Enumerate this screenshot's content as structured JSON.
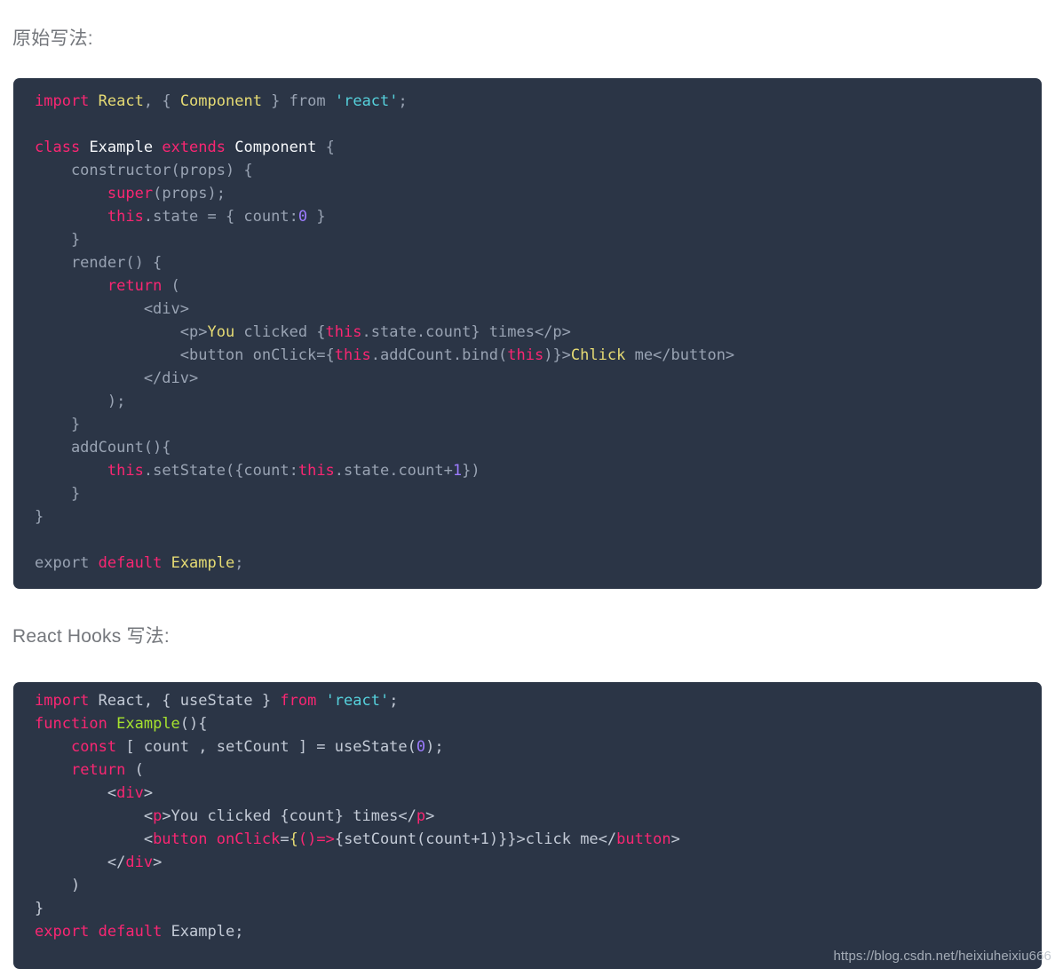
{
  "page": {
    "background": "#ffffff",
    "code_background": "#2b3546",
    "heading_color": "#74777c"
  },
  "headings": {
    "first": "原始写法:",
    "second": "React Hooks 写法:"
  },
  "watermark": "https://blog.csdn.net/heixiuheixiu666",
  "palette": {
    "keyword_pink": "#f92672",
    "yellow": "#e6db74",
    "cyan": "#56d1dc",
    "green": "#a6e22e",
    "purple": "#9d7cff",
    "grey": "#c3cad6",
    "white": "#f5f7fa"
  },
  "code_block_1": {
    "language": "jsx",
    "lines": [
      [
        {
          "t": "import",
          "c": "t-kw"
        },
        {
          "t": " ",
          "c": "t-plain"
        },
        {
          "t": "React",
          "c": "t-yellow"
        },
        {
          "t": ", { ",
          "c": "t-grey"
        },
        {
          "t": "Component",
          "c": "t-yellow"
        },
        {
          "t": " } ",
          "c": "t-grey"
        },
        {
          "t": "from",
          "c": "t-grey"
        },
        {
          "t": " ",
          "c": "t-plain"
        },
        {
          "t": "'react'",
          "c": "t-cyan"
        },
        {
          "t": ";",
          "c": "t-grey"
        }
      ],
      [
        {
          "t": "",
          "c": "t-plain"
        }
      ],
      [
        {
          "t": "class",
          "c": "t-kw"
        },
        {
          "t": " ",
          "c": "t-plain"
        },
        {
          "t": "Example",
          "c": "t-white"
        },
        {
          "t": " ",
          "c": "t-plain"
        },
        {
          "t": "extends",
          "c": "t-kw"
        },
        {
          "t": " ",
          "c": "t-plain"
        },
        {
          "t": "Component",
          "c": "t-white"
        },
        {
          "t": " {",
          "c": "t-grey"
        }
      ],
      [
        {
          "t": "    constructor(props) {",
          "c": "t-grey"
        }
      ],
      [
        {
          "t": "        ",
          "c": "t-plain"
        },
        {
          "t": "super",
          "c": "t-kw2"
        },
        {
          "t": "(props);",
          "c": "t-grey"
        }
      ],
      [
        {
          "t": "        ",
          "c": "t-plain"
        },
        {
          "t": "this",
          "c": "t-kw2"
        },
        {
          "t": ".state = { count:",
          "c": "t-grey"
        },
        {
          "t": "0",
          "c": "t-purple"
        },
        {
          "t": " }",
          "c": "t-grey"
        }
      ],
      [
        {
          "t": "    }",
          "c": "t-grey"
        }
      ],
      [
        {
          "t": "    render() {",
          "c": "t-grey"
        }
      ],
      [
        {
          "t": "        ",
          "c": "t-plain"
        },
        {
          "t": "return",
          "c": "t-kw"
        },
        {
          "t": " (",
          "c": "t-grey"
        }
      ],
      [
        {
          "t": "            <div>",
          "c": "t-grey"
        }
      ],
      [
        {
          "t": "                <p>",
          "c": "t-grey"
        },
        {
          "t": "You",
          "c": "t-yellow"
        },
        {
          "t": " clicked {",
          "c": "t-grey"
        },
        {
          "t": "this",
          "c": "t-kw2"
        },
        {
          "t": ".state.count} times</p>",
          "c": "t-grey"
        }
      ],
      [
        {
          "t": "                <button onClick={",
          "c": "t-grey"
        },
        {
          "t": "this",
          "c": "t-kw2"
        },
        {
          "t": ".addCount.bind(",
          "c": "t-grey"
        },
        {
          "t": "this",
          "c": "t-kw2"
        },
        {
          "t": ")}>",
          "c": "t-grey"
        },
        {
          "t": "Chlick",
          "c": "t-yellow"
        },
        {
          "t": " me</button>",
          "c": "t-grey"
        }
      ],
      [
        {
          "t": "            </div>",
          "c": "t-grey"
        }
      ],
      [
        {
          "t": "        );",
          "c": "t-grey"
        }
      ],
      [
        {
          "t": "    }",
          "c": "t-grey"
        }
      ],
      [
        {
          "t": "    addCount(){",
          "c": "t-grey"
        }
      ],
      [
        {
          "t": "        ",
          "c": "t-plain"
        },
        {
          "t": "this",
          "c": "t-kw2"
        },
        {
          "t": ".setState({count:",
          "c": "t-grey"
        },
        {
          "t": "this",
          "c": "t-kw2"
        },
        {
          "t": ".state.count+",
          "c": "t-grey"
        },
        {
          "t": "1",
          "c": "t-purple"
        },
        {
          "t": "})",
          "c": "t-grey"
        }
      ],
      [
        {
          "t": "    }",
          "c": "t-grey"
        }
      ],
      [
        {
          "t": "}",
          "c": "t-grey"
        }
      ],
      [
        {
          "t": "",
          "c": "t-plain"
        }
      ],
      [
        {
          "t": "export",
          "c": "t-grey"
        },
        {
          "t": " ",
          "c": "t-plain"
        },
        {
          "t": "default",
          "c": "t-kw"
        },
        {
          "t": " ",
          "c": "t-plain"
        },
        {
          "t": "Example",
          "c": "t-yellow"
        },
        {
          "t": ";",
          "c": "t-grey"
        }
      ]
    ]
  },
  "code_block_2": {
    "language": "jsx",
    "lines": [
      [
        {
          "t": "import",
          "c": "h-pink"
        },
        {
          "t": " React, { useState } ",
          "c": "h-grey"
        },
        {
          "t": "from",
          "c": "h-pink"
        },
        {
          "t": " ",
          "c": "h-grey"
        },
        {
          "t": "'react'",
          "c": "h-cyan"
        },
        {
          "t": ";",
          "c": "h-grey"
        }
      ],
      [
        {
          "t": "function",
          "c": "h-pink"
        },
        {
          "t": " ",
          "c": "h-grey"
        },
        {
          "t": "Example",
          "c": "h-green"
        },
        {
          "t": "(){",
          "c": "h-grey"
        }
      ],
      [
        {
          "t": "    ",
          "c": "h-grey"
        },
        {
          "t": "const",
          "c": "h-pink"
        },
        {
          "t": " [ count , setCount ] = useState(",
          "c": "h-grey"
        },
        {
          "t": "0",
          "c": "h-purple"
        },
        {
          "t": ");",
          "c": "h-grey"
        }
      ],
      [
        {
          "t": "    ",
          "c": "h-grey"
        },
        {
          "t": "return",
          "c": "h-pink"
        },
        {
          "t": " (",
          "c": "h-grey"
        }
      ],
      [
        {
          "t": "        <",
          "c": "h-grey"
        },
        {
          "t": "div",
          "c": "h-pink"
        },
        {
          "t": ">",
          "c": "h-grey"
        }
      ],
      [
        {
          "t": "            <",
          "c": "h-grey"
        },
        {
          "t": "p",
          "c": "h-pink"
        },
        {
          "t": ">You clicked {count} times</",
          "c": "h-grey"
        },
        {
          "t": "p",
          "c": "h-pink"
        },
        {
          "t": ">",
          "c": "h-grey"
        }
      ],
      [
        {
          "t": "            <",
          "c": "h-grey"
        },
        {
          "t": "button",
          "c": "h-pink"
        },
        {
          "t": " ",
          "c": "h-grey"
        },
        {
          "t": "onClick",
          "c": "h-pink"
        },
        {
          "t": "=",
          "c": "h-grey"
        },
        {
          "t": "{",
          "c": "h-yellow"
        },
        {
          "t": "()",
          "c": "h-pink"
        },
        {
          "t": "=>",
          "c": "h-pink"
        },
        {
          "t": "{setCount(count+1)}}>click me</",
          "c": "h-grey"
        },
        {
          "t": "button",
          "c": "h-pink"
        },
        {
          "t": ">",
          "c": "h-grey"
        }
      ],
      [
        {
          "t": "        </",
          "c": "h-grey"
        },
        {
          "t": "div",
          "c": "h-pink"
        },
        {
          "t": ">",
          "c": "h-grey"
        }
      ],
      [
        {
          "t": "    )",
          "c": "h-grey"
        }
      ],
      [
        {
          "t": "}",
          "c": "h-grey"
        }
      ],
      [
        {
          "t": "export",
          "c": "h-pink"
        },
        {
          "t": " ",
          "c": "h-grey"
        },
        {
          "t": "default",
          "c": "h-pink"
        },
        {
          "t": " Example;",
          "c": "h-grey"
        }
      ]
    ]
  }
}
